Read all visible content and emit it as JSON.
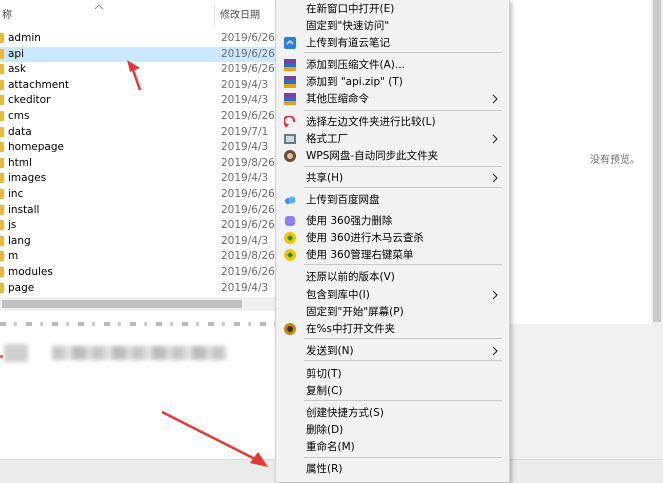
{
  "explorer": {
    "columns": {
      "name": "称",
      "date": "修改日期"
    },
    "files": [
      {
        "name": "admin",
        "date": "2019/6/26",
        "selected": false
      },
      {
        "name": "api",
        "date": "2019/6/26",
        "selected": true
      },
      {
        "name": "ask",
        "date": "2019/6/26",
        "selected": false
      },
      {
        "name": "attachment",
        "date": "2019/4/3",
        "selected": false
      },
      {
        "name": "ckeditor",
        "date": "2019/4/3",
        "selected": false
      },
      {
        "name": "cms",
        "date": "2019/6/26",
        "selected": false
      },
      {
        "name": "data",
        "date": "2019/7/1",
        "selected": false
      },
      {
        "name": "homepage",
        "date": "2019/4/3",
        "selected": false
      },
      {
        "name": "html",
        "date": "2019/8/26",
        "selected": false
      },
      {
        "name": "images",
        "date": "2019/4/3",
        "selected": false
      },
      {
        "name": "inc",
        "date": "2019/6/26",
        "selected": false
      },
      {
        "name": "install",
        "date": "2019/6/26",
        "selected": false
      },
      {
        "name": "js",
        "date": "2019/6/26",
        "selected": false
      },
      {
        "name": "lang",
        "date": "2019/4/3",
        "selected": false
      },
      {
        "name": "m",
        "date": "2019/8/26",
        "selected": false
      },
      {
        "name": "modules",
        "date": "2019/6/26",
        "selected": false
      },
      {
        "name": "page",
        "date": "2019/4/3",
        "selected": false
      }
    ],
    "preview_text": "没有预览。",
    "folder_color": "#e8b93c",
    "selection_color": "#cce8ff"
  },
  "context_menu": {
    "items": [
      {
        "label": "在新窗口中打开(E)",
        "icon": "",
        "submenu": false
      },
      {
        "label": "固定到\"快速访问\"",
        "icon": "",
        "submenu": false
      },
      {
        "label": "上传到有道云笔记",
        "icon": "youdao-note-icon",
        "submenu": false
      },
      {
        "label": "添加到压缩文件(A)...",
        "icon": "winrar-icon",
        "submenu": false
      },
      {
        "label": "添加到 \"api.zip\" (T)",
        "icon": "winrar-icon",
        "submenu": false
      },
      {
        "label": "其他压缩命令",
        "icon": "winrar-icon",
        "submenu": true
      },
      {
        "label": "选择左边文件夹进行比较(L)",
        "icon": "compare-icon",
        "submenu": false
      },
      {
        "label": "格式工厂",
        "icon": "format-factory-icon",
        "submenu": true
      },
      {
        "label": "WPS网盘-自动同步此文件夹",
        "icon": "wps-icon",
        "submenu": false
      },
      {
        "label": "共享(H)",
        "icon": "",
        "submenu": true
      },
      {
        "label": "上传到百度网盘",
        "icon": "baidu-netdisk-icon",
        "submenu": false
      },
      {
        "label": "使用 360强力删除",
        "icon": "360-delete-icon",
        "submenu": false
      },
      {
        "label": "使用 360进行木马云查杀",
        "icon": "360-scan-icon",
        "submenu": false
      },
      {
        "label": "使用 360管理右键菜单",
        "icon": "360-menu-icon",
        "submenu": false
      },
      {
        "label": "还原以前的版本(V)",
        "icon": "",
        "submenu": false
      },
      {
        "label": "包含到库中(I)",
        "icon": "",
        "submenu": true
      },
      {
        "label": "固定到\"开始\"屏幕(P)",
        "icon": "",
        "submenu": false
      },
      {
        "label": "在%s中打开文件夹",
        "icon": "globe-icon",
        "submenu": false
      },
      {
        "label": "发送到(N)",
        "icon": "",
        "submenu": true
      },
      {
        "label": "剪切(T)",
        "icon": "",
        "submenu": false
      },
      {
        "label": "复制(C)",
        "icon": "",
        "submenu": false
      },
      {
        "label": "创建快捷方式(S)",
        "icon": "",
        "submenu": false
      },
      {
        "label": "删除(D)",
        "icon": "",
        "submenu": false
      },
      {
        "label": "重命名(M)",
        "icon": "",
        "submenu": false
      },
      {
        "label": "属性(R)",
        "icon": "",
        "submenu": false
      }
    ]
  },
  "annotation_color": "#e53935"
}
